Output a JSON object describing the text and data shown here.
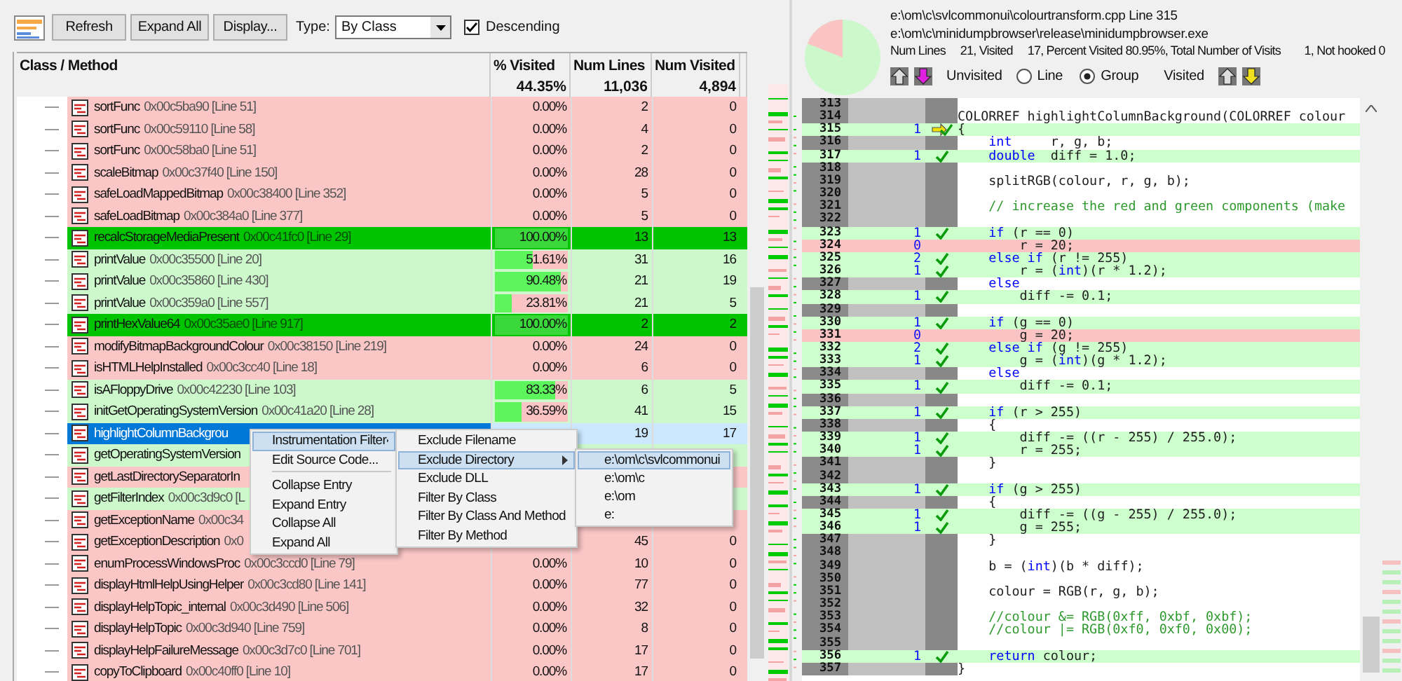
{
  "toolbar": {
    "buttons": [
      "Refresh",
      "Expand All",
      "Display..."
    ],
    "type_label": "Type:",
    "type_value": "By Class",
    "descending": {
      "label": "Descending",
      "checked": true
    }
  },
  "table": {
    "columns": [
      "Class / Method",
      "% Visited",
      "Num Lines",
      "Num Visited"
    ],
    "totals": [
      "44.35%",
      "11,036",
      "4,894"
    ],
    "rows": [
      {
        "name": "sortFunc",
        "address": "0x00c5ba90 [Line 51]",
        "kind": "none",
        "pct": "0.00%",
        "level": 0,
        "lines": "2",
        "visited": "0",
        "selected": false
      },
      {
        "name": "sortFunc",
        "address": "0x00c59110 [Line 58]",
        "kind": "none",
        "pct": "0.00%",
        "level": 0,
        "lines": "4",
        "visited": "0",
        "selected": false
      },
      {
        "name": "sortFunc",
        "address": "0x00c58ba0 [Line 51]",
        "kind": "none",
        "pct": "0.00%",
        "level": 0,
        "lines": "2",
        "visited": "0",
        "selected": false
      },
      {
        "name": "scaleBitmap",
        "address": "0x00c37f40 [Line 150]",
        "kind": "none",
        "pct": "0.00%",
        "level": 0,
        "lines": "28",
        "visited": "0",
        "selected": false
      },
      {
        "name": "safeLoadMappedBitmap",
        "address": "0x00c38400 [Line 352]",
        "kind": "none",
        "pct": "0.00%",
        "level": 0,
        "lines": "5",
        "visited": "0",
        "selected": false
      },
      {
        "name": "safeLoadBitmap",
        "address": "0x00c384a0 [Line 377]",
        "kind": "none",
        "pct": "0.00%",
        "level": 0,
        "lines": "5",
        "visited": "0",
        "selected": false
      },
      {
        "name": "recalcStorageMediaPresent",
        "address": "0x00c41fc0 [Line 29]",
        "kind": "full",
        "pct": "100.00%",
        "level": 1,
        "lines": "13",
        "visited": "13",
        "selected": false
      },
      {
        "name": "printValue",
        "address": "0x00c35500 [Line 20]",
        "kind": "partial",
        "pct": "51.61%",
        "level": 0.5161,
        "lines": "31",
        "visited": "16",
        "selected": false
      },
      {
        "name": "printValue",
        "address": "0x00c35860 [Line 430]",
        "kind": "partial",
        "pct": "90.48%",
        "level": 0.9048,
        "lines": "21",
        "visited": "19",
        "selected": false
      },
      {
        "name": "printValue",
        "address": "0x00c359a0 [Line 557]",
        "kind": "partial",
        "pct": "23.81%",
        "level": 0.2381,
        "lines": "21",
        "visited": "5",
        "selected": false
      },
      {
        "name": "printHexValue64",
        "address": "0x00c35ae0 [Line 917]",
        "kind": "full",
        "pct": "100.00%",
        "level": 1,
        "lines": "2",
        "visited": "2",
        "selected": false
      },
      {
        "name": "modifyBitmapBackgroundColour",
        "address": "0x00c38150 [Line 219]",
        "kind": "none",
        "pct": "0.00%",
        "level": 0,
        "lines": "24",
        "visited": "0",
        "selected": false
      },
      {
        "name": "isHTMLHelpInstalled",
        "address": "0x00c3cc40 [Line 18]",
        "kind": "none",
        "pct": "0.00%",
        "level": 0,
        "lines": "6",
        "visited": "0",
        "selected": false
      },
      {
        "name": "isAFloppyDrive",
        "address": "0x00c42230 [Line 103]",
        "kind": "partial",
        "pct": "83.33%",
        "level": 0.8333,
        "lines": "6",
        "visited": "5",
        "selected": false
      },
      {
        "name": "initGetOperatingSystemVersion",
        "address": "0x00c41a20 [Line 28]",
        "kind": "partial",
        "pct": "36.59%",
        "level": 0.3659,
        "lines": "41",
        "visited": "15",
        "selected": false
      },
      {
        "name": "highlightColumnBackgrou",
        "kind": "partial",
        "lines": "19",
        "visited": "17",
        "selected": true
      },
      {
        "name": "getOperatingSystemVersion",
        "kind": "partial",
        "selected": false
      },
      {
        "name": "getLastDirectorySeparatorIn",
        "kind": "none",
        "selected": false
      },
      {
        "name": "getFilterIndex",
        "address": "0x00c3d9c0 [L",
        "kind": "partial",
        "selected": false
      },
      {
        "name": "getExceptionName",
        "address": "0x00c34",
        "kind": "none",
        "selected": false
      },
      {
        "name": "getExceptionDescription",
        "address": "0x0",
        "kind": "none",
        "lines": "45",
        "visited": "0",
        "selected": false
      },
      {
        "name": "enumProcessWindowsProc",
        "address": "0x00c3ccd0 [Line 79]",
        "kind": "none",
        "pct": "0.00%",
        "level": 0,
        "lines": "10",
        "visited": "0",
        "selected": false
      },
      {
        "name": "displayHtmlHelpUsingHelper",
        "address": "0x00c3cd80 [Line 141]",
        "kind": "none",
        "pct": "0.00%",
        "level": 0,
        "lines": "77",
        "visited": "0",
        "selected": false
      },
      {
        "name": "displayHelpTopic_internal",
        "address": "0x00c3d490 [Line 506]",
        "kind": "none",
        "pct": "0.00%",
        "level": 0,
        "lines": "32",
        "visited": "0",
        "selected": false
      },
      {
        "name": "displayHelpTopic",
        "address": "0x00c3d940 [Line 759]",
        "kind": "none",
        "pct": "0.00%",
        "level": 0,
        "lines": "8",
        "visited": "0",
        "selected": false
      },
      {
        "name": "displayHelpFailureMessage",
        "address": "0x00c3d7c0 [Line 701]",
        "kind": "none",
        "pct": "0.00%",
        "level": 0,
        "lines": "17",
        "visited": "0",
        "selected": false
      },
      {
        "name": "copyToClipboard",
        "address": "0x00c40ff0 [Line 10]",
        "kind": "none",
        "pct": "0.00%",
        "level": 0,
        "lines": "17",
        "visited": "0",
        "selected": false
      }
    ]
  },
  "context_menu": {
    "items": [
      {
        "label": "Instrumentation Filter",
        "submenu": true,
        "selected": true
      },
      {
        "label": "Edit Source Code...",
        "submenu": false,
        "selected": false,
        "separator_after": true
      },
      {
        "label": "Collapse Entry",
        "submenu": false,
        "selected": false
      },
      {
        "label": "Expand Entry",
        "submenu": false,
        "selected": false
      },
      {
        "label": "Collapse All",
        "submenu": false,
        "selected": false
      },
      {
        "label": "Expand All",
        "submenu": false,
        "selected": false
      }
    ],
    "submenu": [
      {
        "label": "Exclude Filename",
        "submenu": false,
        "selected": false
      },
      {
        "label": "Exclude Directory",
        "submenu": true,
        "selected": true
      },
      {
        "label": "Exclude DLL",
        "submenu": false,
        "selected": false
      },
      {
        "label": "Filter By Class",
        "submenu": false,
        "selected": false
      },
      {
        "label": "Filter By Class And Method",
        "submenu": false,
        "selected": false
      },
      {
        "label": "Filter By Method",
        "submenu": false,
        "selected": false
      }
    ],
    "directories": [
      {
        "label": "e:\\om\\c\\svlcommonui",
        "selected": true
      },
      {
        "label": "e:\\om\\c",
        "selected": false
      },
      {
        "label": "e:\\om",
        "selected": false
      },
      {
        "label": "e:",
        "selected": false
      }
    ]
  },
  "details": {
    "source": "e:\\om\\c\\svlcommonui\\colourtransform.cpp Line 315",
    "module": "e:\\om\\c\\minidumpbrowser\\release\\minidumpbrowser.exe",
    "stats": "Num Lines     21, Visited     17, Percent Visited 80.95%, Total Number of Visits        1, Not hooked 0",
    "unvisited_label": "Unvisited",
    "visited_label": "Visited",
    "modes": [
      {
        "label": "Line",
        "selected": false
      },
      {
        "label": "Group",
        "selected": true
      }
    ]
  },
  "source": {
    "lines": [
      {
        "number": "313",
        "kind": "plain"
      },
      {
        "number": "314",
        "kind": "plain",
        "code": [
          {
            "kind": "plain",
            "text": "COLORREF highlightColumnBackground(COLORREF colour"
          }
        ]
      },
      {
        "number": "315",
        "kind": "current",
        "count": "1",
        "code": [
          {
            "kind": "plain",
            "text": "{"
          }
        ]
      },
      {
        "number": "316",
        "kind": "plain",
        "code": [
          {
            "kind": "kw",
            "text": "    int"
          },
          {
            "kind": "plain",
            "text": "     r, g, b;"
          }
        ]
      },
      {
        "number": "317",
        "kind": "visited",
        "count": "1",
        "code": [
          {
            "kind": "kw",
            "text": "    double"
          },
          {
            "kind": "plain",
            "text": "  diff = 1.0;"
          }
        ]
      },
      {
        "number": "318",
        "kind": "plain"
      },
      {
        "number": "319",
        "kind": "plain",
        "code": [
          {
            "kind": "plain",
            "text": "    splitRGB(colour, r, g, b);"
          }
        ]
      },
      {
        "number": "320",
        "kind": "plain"
      },
      {
        "number": "321",
        "kind": "plain",
        "code": [
          {
            "kind": "comment",
            "text": "    // increase the red and green components (make"
          }
        ]
      },
      {
        "number": "322",
        "kind": "plain"
      },
      {
        "number": "323",
        "kind": "visited",
        "count": "1",
        "code": [
          {
            "kind": "kw",
            "text": "    if"
          },
          {
            "kind": "plain",
            "text": " (r == 0)"
          }
        ]
      },
      {
        "number": "324",
        "kind": "unvisited",
        "count": "0",
        "code": [
          {
            "kind": "plain",
            "text": "        r = 20;"
          }
        ]
      },
      {
        "number": "325",
        "kind": "visited",
        "count": "2",
        "code": [
          {
            "kind": "kw",
            "text": "    else if"
          },
          {
            "kind": "plain",
            "text": " (r != 255)"
          }
        ]
      },
      {
        "number": "326",
        "kind": "visited",
        "count": "1",
        "code": [
          {
            "kind": "plain",
            "text": "        r = ("
          },
          {
            "kind": "kw",
            "text": "int"
          },
          {
            "kind": "plain",
            "text": ")(r * 1.2);"
          }
        ]
      },
      {
        "number": "327",
        "kind": "plain",
        "code": [
          {
            "kind": "kw",
            "text": "    else"
          }
        ]
      },
      {
        "number": "328",
        "kind": "visited",
        "count": "1",
        "code": [
          {
            "kind": "plain",
            "text": "        diff -= 0.1;"
          }
        ]
      },
      {
        "number": "329",
        "kind": "plain"
      },
      {
        "number": "330",
        "kind": "visited",
        "count": "1",
        "code": [
          {
            "kind": "kw",
            "text": "    if"
          },
          {
            "kind": "plain",
            "text": " (g == 0)"
          }
        ]
      },
      {
        "number": "331",
        "kind": "unvisited",
        "count": "0",
        "code": [
          {
            "kind": "plain",
            "text": "        g = 20;"
          }
        ]
      },
      {
        "number": "332",
        "kind": "visited",
        "count": "2",
        "code": [
          {
            "kind": "kw",
            "text": "    else if"
          },
          {
            "kind": "plain",
            "text": " (g != 255)"
          }
        ]
      },
      {
        "number": "333",
        "kind": "visited",
        "count": "1",
        "code": [
          {
            "kind": "plain",
            "text": "        g = ("
          },
          {
            "kind": "kw",
            "text": "int"
          },
          {
            "kind": "plain",
            "text": ")(g * 1.2);"
          }
        ]
      },
      {
        "number": "334",
        "kind": "plain",
        "code": [
          {
            "kind": "kw",
            "text": "    else"
          }
        ]
      },
      {
        "number": "335",
        "kind": "visited",
        "count": "1",
        "code": [
          {
            "kind": "plain",
            "text": "        diff -= 0.1;"
          }
        ]
      },
      {
        "number": "336",
        "kind": "plain"
      },
      {
        "number": "337",
        "kind": "visited",
        "count": "1",
        "code": [
          {
            "kind": "kw",
            "text": "    if"
          },
          {
            "kind": "plain",
            "text": " (r > 255)"
          }
        ]
      },
      {
        "number": "338",
        "kind": "plain",
        "code": [
          {
            "kind": "plain",
            "text": "    {"
          }
        ]
      },
      {
        "number": "339",
        "kind": "visited",
        "count": "1",
        "code": [
          {
            "kind": "plain",
            "text": "        diff -= ((r - 255) / 255.0);"
          }
        ]
      },
      {
        "number": "340",
        "kind": "visited",
        "count": "1",
        "code": [
          {
            "kind": "plain",
            "text": "        r = 255;"
          }
        ]
      },
      {
        "number": "341",
        "kind": "plain",
        "code": [
          {
            "kind": "plain",
            "text": "    }"
          }
        ]
      },
      {
        "number": "342",
        "kind": "plain"
      },
      {
        "number": "343",
        "kind": "visited",
        "count": "1",
        "code": [
          {
            "kind": "kw",
            "text": "    if"
          },
          {
            "kind": "plain",
            "text": " (g > 255)"
          }
        ]
      },
      {
        "number": "344",
        "kind": "plain",
        "code": [
          {
            "kind": "plain",
            "text": "    {"
          }
        ]
      },
      {
        "number": "345",
        "kind": "visited",
        "count": "1",
        "code": [
          {
            "kind": "plain",
            "text": "        diff -= ((g - 255) / 255.0);"
          }
        ]
      },
      {
        "number": "346",
        "kind": "visited",
        "count": "1",
        "code": [
          {
            "kind": "plain",
            "text": "        g = 255;"
          }
        ]
      },
      {
        "number": "347",
        "kind": "plain",
        "code": [
          {
            "kind": "plain",
            "text": "    }"
          }
        ]
      },
      {
        "number": "348",
        "kind": "plain"
      },
      {
        "number": "349",
        "kind": "plain",
        "code": [
          {
            "kind": "plain",
            "text": "    b = ("
          },
          {
            "kind": "kw",
            "text": "int"
          },
          {
            "kind": "plain",
            "text": ")(b * diff);"
          }
        ]
      },
      {
        "number": "350",
        "kind": "plain"
      },
      {
        "number": "351",
        "kind": "plain",
        "code": [
          {
            "kind": "plain",
            "text": "    colour = RGB(r, g, b);"
          }
        ]
      },
      {
        "number": "352",
        "kind": "plain"
      },
      {
        "number": "353",
        "kind": "plain",
        "code": [
          {
            "kind": "comment",
            "text": "    //colour &= RGB(0xff, 0xbf, 0xbf);"
          }
        ]
      },
      {
        "number": "354",
        "kind": "plain",
        "code": [
          {
            "kind": "comment",
            "text": "    //colour |= RGB(0xf0, 0xf0, 0x00);"
          }
        ]
      },
      {
        "number": "355",
        "kind": "plain"
      },
      {
        "number": "356",
        "kind": "visited",
        "count": "1",
        "code": [
          {
            "kind": "kw",
            "text": "    return"
          },
          {
            "kind": "plain",
            "text": " colour;"
          }
        ]
      },
      {
        "number": "357",
        "kind": "plain",
        "code": [
          {
            "kind": "plain",
            "text": "}"
          }
        ]
      }
    ]
  }
}
